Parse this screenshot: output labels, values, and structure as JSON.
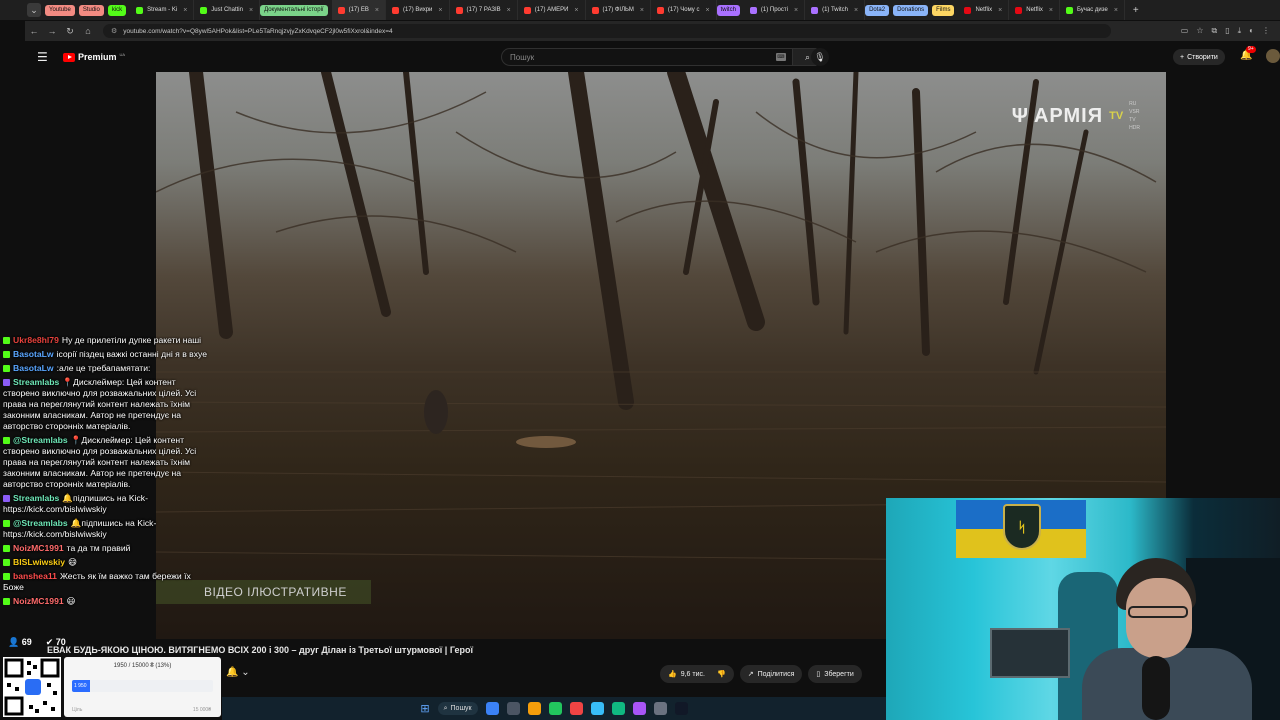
{
  "browser": {
    "pills": [
      {
        "label": "Youtube",
        "color": "#f28b82"
      },
      {
        "label": "Studio",
        "color": "#f28b82"
      },
      {
        "label": "kick",
        "color": "#53fc18"
      }
    ],
    "tabs": [
      {
        "label": "Stream - Ki",
        "fav": "#53fc18",
        "active": false
      },
      {
        "label": "Just Chattin",
        "fav": "#53fc18",
        "active": false
      },
      {
        "label": "Документальні історії",
        "fav": "#7bd389",
        "active": false,
        "pill": true
      },
      {
        "label": "(17) EB",
        "fav": "#ff3b30",
        "active": true
      },
      {
        "label": "(17) Вихри",
        "fav": "#ff3b30",
        "active": false
      },
      {
        "label": "(17) 7 РАЗІВ",
        "fav": "#ff3b30",
        "active": false
      },
      {
        "label": "(17) АМЕРИ",
        "fav": "#ff3b30",
        "active": false
      },
      {
        "label": "(17) ФІЛЬМ",
        "fav": "#ff3b30",
        "active": false
      },
      {
        "label": "(17) Чому с",
        "fav": "#ff3b30",
        "active": false
      },
      {
        "label": "twitch",
        "fav": "#a970ff",
        "active": false,
        "pill": true
      },
      {
        "label": "(1) Прості",
        "fav": "#a970ff",
        "active": false
      },
      {
        "label": "(1) Twitch",
        "fav": "#a970ff",
        "active": false
      },
      {
        "label": "Dota2",
        "fav": "#8ab4f8",
        "active": false,
        "pill": true
      },
      {
        "label": "Donations",
        "fav": "#8ab4f8",
        "active": false,
        "pill": true
      },
      {
        "label": "Films",
        "fav": "#fdd663",
        "active": false,
        "pill": true
      },
      {
        "label": "Netflix",
        "fav": "#e50914",
        "active": false
      },
      {
        "label": "Netflix",
        "fav": "#e50914",
        "active": false
      },
      {
        "label": "Бучас дизе",
        "fav": "#53fc18",
        "active": false
      }
    ],
    "url": "youtube.com/watch?v=Q8ywl5AHPok&list=PLe5TaRnqjzvjyZxKdvqeCF2jl0w5fiXxrol&index=4"
  },
  "youtube": {
    "premium_label": "Premium",
    "premium_sup": "UA",
    "search_placeholder": "Пошук",
    "create_label": "Створити",
    "notif_count": "9+",
    "video": {
      "watermark": "АРМІЯ",
      "watermark_tv": "TV",
      "watermark_tags": [
        "RU",
        "VSR",
        "TV",
        "HDR"
      ],
      "caption": "ВІДЕО ІЛЮСТРАТИВНЕ",
      "title": "ЕВАК БУДЬ-ЯКОЮ ЦІНОЮ. ВИТЯГНЕМО ВСІХ 200 і 300 – друг Ділан із Третьої штурмової | Герої"
    },
    "actions": {
      "likes": "9,6 тис.",
      "share": "Поділитися",
      "save": "Зберегти"
    }
  },
  "chat": {
    "messages": [
      {
        "user": "Ukr8e8hl79",
        "color": "#e6423c",
        "badge": "kick",
        "text": "Ну де прилетіли дупке ракети наші"
      },
      {
        "user": "BasotaLw",
        "color": "#5aa6ff",
        "badge": "kick",
        "text": "ісорії піздец важкі останні дні я в вхуе"
      },
      {
        "user": "BasotaLw",
        "color": "#5aa6ff",
        "badge": "kick",
        "text": ":але це требапамятати:"
      },
      {
        "user": "Streamlabs",
        "color": "#6ee7b7",
        "badge": "sl",
        "text": "📍Дисклеймер: Цей контент створено виключно для розважальних цілей. Усі права на переглянутий контент належать їхнім законним власникам. Автор не претендує на авторство сторонніх матеріалів."
      },
      {
        "user": "@Streamlabs",
        "color": "#6ee7b7",
        "badge": "kick",
        "text": "📍Дисклеймер: Цей контент створено виключно для розважальних цілей. Усі права на переглянутий контент належать їхнім законним власникам. Автор не претендує на авторство сторонніх матеріалів."
      },
      {
        "user": "Streamlabs",
        "color": "#6ee7b7",
        "badge": "sl",
        "text": "🔔підпишись на Kick- https://kick.com/bislwiwskiy"
      },
      {
        "user": "@Streamlabs",
        "color": "#6ee7b7",
        "badge": "kick",
        "text": "🔔підпишись на Kick- https://kick.com/bislwiwskiy"
      },
      {
        "user": "NoizMC1991",
        "color": "#ff6b6b",
        "badge": "kick",
        "text": "та да тм правий"
      },
      {
        "user": "BISLwiwskiy",
        "color": "#facc15",
        "badge": "kick",
        "text": "😄"
      },
      {
        "user": "banshea11",
        "color": "#ff4d4d",
        "badge": "kick",
        "text": "Жесть як їм важко там бережи їх Боже"
      },
      {
        "user": "NoizMC1991",
        "color": "#ff6b6b",
        "badge": "kick",
        "text": "😃"
      }
    ],
    "stats": {
      "viewers": "69",
      "followers": "70"
    }
  },
  "donation": {
    "goal_text": "1950 / 15000 ₴ (13%)",
    "progress_fraction": 0.13,
    "fill_label": "1 950",
    "goal_label": "Ціль",
    "goal_total": "15 000₴"
  },
  "taskbar": {
    "search_label": "Пошук",
    "icons": [
      "#3b82f6",
      "#4b5563",
      "#f59e0b",
      "#22c55e",
      "#ef4444",
      "#38bdf8",
      "#10b981",
      "#a855f7",
      "#6b7280",
      "#111827"
    ]
  }
}
